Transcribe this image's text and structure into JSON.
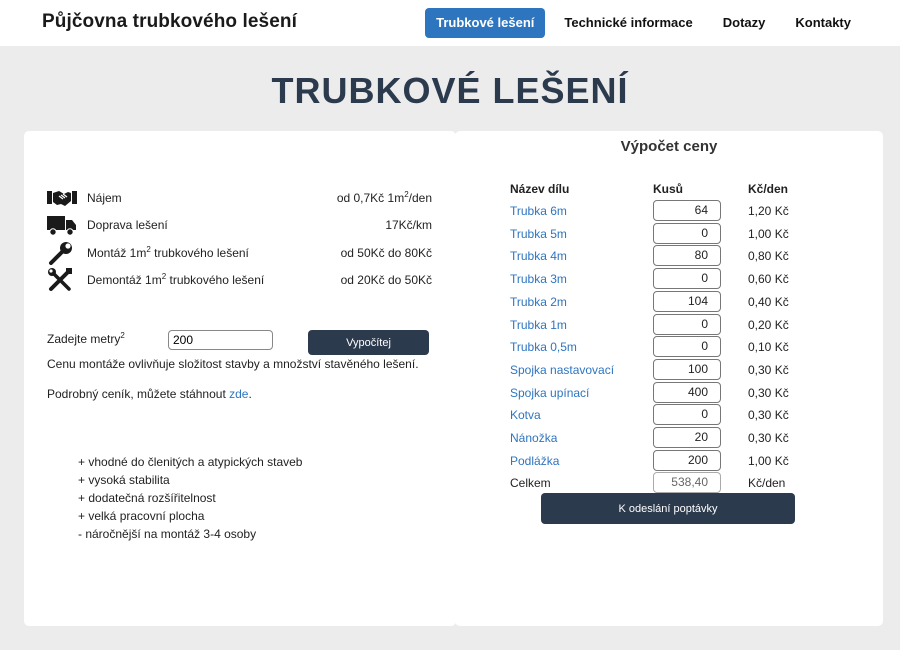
{
  "header": {
    "brand": "Půjčovna trubkového lešení",
    "nav": [
      "Trubkové lešení",
      "Technické informace",
      "Dotazy",
      "Kontakty"
    ]
  },
  "hero": {
    "title": "TRUBKOVÉ LEŠENÍ"
  },
  "services": [
    {
      "icon": "handshake-icon",
      "name": "Nájem",
      "price_pre": "od 0,7Kč 1m",
      "price_sup": "2",
      "price_post": "/den"
    },
    {
      "icon": "truck-icon",
      "name": "Doprava lešení",
      "price_pre": "17Kč/km",
      "price_sup": "",
      "price_post": ""
    },
    {
      "icon": "wrench-icon",
      "name_pre": "Montáž 1m",
      "name_sup": "2",
      "name_post": " trubkového lešení",
      "price_pre": "od 50Kč do 80Kč",
      "price_sup": "",
      "price_post": ""
    },
    {
      "icon": "tools-icon",
      "name_pre": "Demontáž 1m",
      "name_sup": "2",
      "name_post": " trubkového lešení",
      "price_pre": "od 20Kč do 50Kč",
      "price_sup": "",
      "price_post": ""
    }
  ],
  "calculator": {
    "label_pre": "Zadejte metry",
    "label_sup": "2",
    "value": "200",
    "button": "Vypočítej",
    "note": "Cenu montáže ovlivňuje složitost stavby a množství stavěného lešení.",
    "pricelist_pre": "Podrobný ceník, můžete stáhnout ",
    "pricelist_link": "zde",
    "pricelist_post": "."
  },
  "features": [
    "+ vhodné do členitých a atypických staveb",
    "+ vysoká stabilita",
    "+ dodatečná rozšířitelnost",
    "+ velká pracovní plocha",
    "- náročnější na montáž 3-4 osoby"
  ],
  "price_calc": {
    "title": "Výpočet ceny",
    "headers": {
      "name": "Název dílu",
      "qty": "Kusů",
      "unit": "Kč/den"
    },
    "rows": [
      {
        "name": "Trubka 6m",
        "qty": "64",
        "unit": "1,20 Kč"
      },
      {
        "name": "Trubka 5m",
        "qty": "0",
        "unit": "1,00 Kč"
      },
      {
        "name": "Trubka 4m",
        "qty": "80",
        "unit": "0,80 Kč"
      },
      {
        "name": "Trubka 3m",
        "qty": "0",
        "unit": "0,60 Kč"
      },
      {
        "name": "Trubka 2m",
        "qty": "104",
        "unit": "0,40 Kč"
      },
      {
        "name": "Trubka 1m",
        "qty": "0",
        "unit": "0,20 Kč"
      },
      {
        "name": "Trubka 0,5m",
        "qty": "0",
        "unit": "0,10 Kč"
      },
      {
        "name": "Spojka nastavovací",
        "qty": "100",
        "unit": "0,30 Kč"
      },
      {
        "name": "Spojka upínací",
        "qty": "400",
        "unit": "0,30 Kč"
      },
      {
        "name": "Kotva",
        "qty": "0",
        "unit": "0,30 Kč"
      },
      {
        "name": "Nánožka",
        "qty": "20",
        "unit": "0,30 Kč"
      },
      {
        "name": "Podlážka",
        "qty": "200",
        "unit": "1,00 Kč"
      }
    ],
    "total": {
      "name": "Celkem",
      "qty": "538,40",
      "unit": "Kč/den"
    },
    "submit": "K odeslání poptávky"
  },
  "colors": {
    "accent": "#2e75c0",
    "dark": "#2c3a4d",
    "background": "#ececec"
  }
}
